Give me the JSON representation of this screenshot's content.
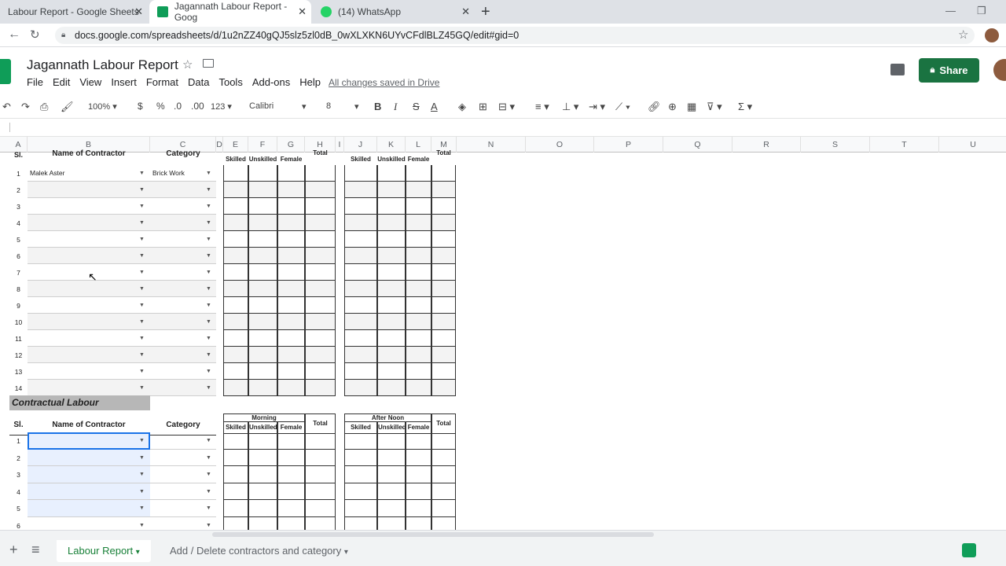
{
  "browser": {
    "tabs": [
      {
        "title": "Labour Report - Google Sheets",
        "active": false
      },
      {
        "title": "Jagannath Labour Report - Goog",
        "active": true
      },
      {
        "title": "(14) WhatsApp",
        "active": false
      }
    ],
    "url": "docs.google.com/spreadsheets/d/1u2nZZ40gQJ5slz5zl0dB_0wXLXKN6UYvCFdlBLZ45GQ/edit#gid=0",
    "new_tab_icon": "+",
    "colors": {
      "tabbar": "#dee1e6",
      "whatsapp": "#25d366",
      "sheets": "#0f9d58"
    }
  },
  "app": {
    "title": "Jagannath Labour Report",
    "menu": [
      "File",
      "Edit",
      "View",
      "Insert",
      "Format",
      "Data",
      "Tools",
      "Add-ons",
      "Help"
    ],
    "saved_status": "All changes saved in Drive",
    "share_label": "Share",
    "share_color": "#1a7341"
  },
  "toolbar": {
    "zoom": "100%",
    "currency": "$",
    "percent": "%",
    "dec_decrease": ".0",
    "dec_increase": ".00",
    "more_formats": "123",
    "font": "Calibri",
    "font_size": "8",
    "bold": "B",
    "italic": "I",
    "strike": "S",
    "text_color": "A",
    "sum": "Σ"
  },
  "columns": [
    "A",
    "B",
    "C",
    "D",
    "E",
    "F",
    "G",
    "H",
    "I",
    "J",
    "K",
    "L",
    "M",
    "N",
    "O",
    "P",
    "Q",
    "R",
    "S",
    "T",
    "U"
  ],
  "table1": {
    "header_sl": "Sl.",
    "header_name": "Name of Contractor",
    "header_category": "Category",
    "sub_skilled": "Skilled",
    "sub_unskilled": "Unskilled",
    "sub_female": "Female",
    "sub_total": "Total",
    "rows": [
      {
        "sl": "1",
        "name": "Malek Aster",
        "category": "Brick Work"
      },
      {
        "sl": "2",
        "name": "",
        "category": ""
      },
      {
        "sl": "3",
        "name": "",
        "category": ""
      },
      {
        "sl": "4",
        "name": "",
        "category": ""
      },
      {
        "sl": "5",
        "name": "",
        "category": ""
      },
      {
        "sl": "6",
        "name": "",
        "category": ""
      },
      {
        "sl": "7",
        "name": "",
        "category": ""
      },
      {
        "sl": "8",
        "name": "",
        "category": ""
      },
      {
        "sl": "9",
        "name": "",
        "category": ""
      },
      {
        "sl": "10",
        "name": "",
        "category": ""
      },
      {
        "sl": "11",
        "name": "",
        "category": ""
      },
      {
        "sl": "12",
        "name": "",
        "category": ""
      },
      {
        "sl": "13",
        "name": "",
        "category": ""
      },
      {
        "sl": "14",
        "name": "",
        "category": ""
      }
    ]
  },
  "table2": {
    "section_title": "Contractual Labour",
    "header_sl": "Sl.",
    "header_name": "Name of Contractor",
    "header_category": "Category",
    "morning": "Morning",
    "afternoon": "After Noon",
    "total": "Total",
    "sub_skilled": "Skilled",
    "sub_unskilled": "Unskilled",
    "sub_female": "Female",
    "rows": [
      "1",
      "2",
      "3",
      "4",
      "5",
      "6"
    ]
  },
  "sheets": [
    {
      "name": "Labour Report",
      "active": true
    },
    {
      "name": "Add / Delete contractors and category",
      "active": false
    }
  ],
  "add_sheet_icon": "+",
  "all_sheets_icon": "≡"
}
